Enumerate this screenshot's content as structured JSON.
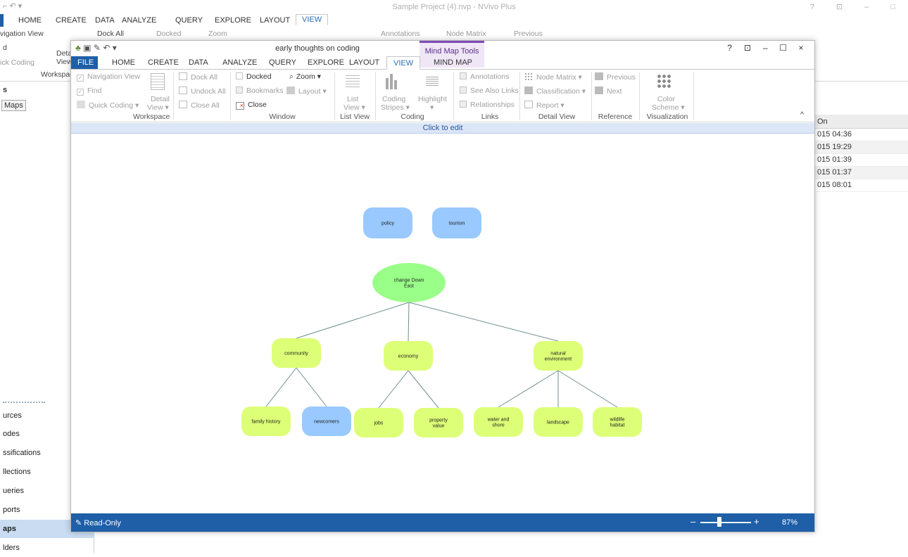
{
  "background_window": {
    "title": "Sample Project (4).nvp - NVivo Plus",
    "tabs": [
      "HOME",
      "CREATE",
      "DATA",
      "ANALYZE",
      "QUERY",
      "EXPLORE",
      "LAYOUT",
      "VIEW"
    ],
    "ribbon": {
      "navigation_view": "vigation View",
      "find": "d",
      "quick_coding": "ick Coding",
      "detail_view": "Deta View",
      "workspace": "Workspac",
      "dock_all": "Dock All",
      "docked": "Docked",
      "zoom": "Zoom",
      "annotations": "Annotations",
      "node_matrix": "Node Matrix",
      "previous": "Previous"
    },
    "left_panel": {
      "heading": "s",
      "maps_button": "Maps",
      "nav_items": [
        "urces",
        "odes",
        "ssifications",
        "llections",
        "ueries",
        "ports",
        "aps",
        "lders"
      ]
    },
    "right_panel": {
      "header": "On",
      "rows": [
        "015 04:36",
        "015 19:29",
        "015 01:39",
        "015 01:37",
        "015 08:01"
      ]
    }
  },
  "popup": {
    "title": "early thoughts on coding",
    "context_tools_label": "Mind Map Tools",
    "tabs": {
      "file": "FILE",
      "home": "HOME",
      "create": "CREATE",
      "data": "DATA",
      "analyze": "ANALYZE",
      "query": "QUERY",
      "explore": "EXPLORE",
      "layout": "LAYOUT",
      "view": "VIEW",
      "mind_map": "MIND MAP"
    },
    "window_controls": {
      "help": "?",
      "restore_ribbon": "⊡",
      "minimize": "–",
      "maximize": "☐",
      "close": "×"
    },
    "ribbon": {
      "workspace": {
        "navigation_view": "Navigation View",
        "find": "Find",
        "quick_coding": "Quick Coding ▾",
        "detail_view_1": "Detail",
        "detail_view_2": "View ▾",
        "group": "Workspace"
      },
      "dock": {
        "dock_all": "Dock All",
        "undock_all": "Undock All",
        "close_all": "Close All"
      },
      "window": {
        "docked": "Docked",
        "bookmarks": "Bookmarks",
        "close": "Close",
        "zoom": "Zoom ▾",
        "layout": "Layout ▾",
        "group": "Window"
      },
      "list_view": {
        "label_1": "List",
        "label_2": "View ▾",
        "group": "List View"
      },
      "coding": {
        "stripes_1": "Coding",
        "stripes_2": "Stripes ▾",
        "highlight": "Highlight",
        "highlight_arrow": "▾",
        "group": "Coding"
      },
      "links": {
        "annotations": "Annotations",
        "see_also": "See Also Links",
        "relationships": "Relationships",
        "group": "Links"
      },
      "detail_view": {
        "node_matrix": "Node Matrix ▾",
        "classification": "Classification ▾",
        "report": "Report ▾",
        "group": "Detail View"
      },
      "reference": {
        "previous": "Previous",
        "next": "Next",
        "group": "Reference"
      },
      "visualization": {
        "color_1": "Color",
        "color_2": "Scheme ▾",
        "group": "Visualization"
      },
      "collapse": "^"
    },
    "click_to_edit": "Click to edit",
    "mind_map": {
      "nodes": {
        "policy": "policy",
        "tourism": "tourism",
        "root_line1": "change Down",
        "root_line2": "East",
        "community": "community",
        "economy": "economy",
        "natural_line1": "natural",
        "natural_line2": "environment",
        "family_history": "family history",
        "newcomers": "newcomers",
        "jobs": "jobs",
        "property_line1": "property",
        "property_line2": "value",
        "water_line1": "water and",
        "water_line2": "shore",
        "landscape": "landscape",
        "wildlife_line1": "wildlife",
        "wildlife_line2": "habitat"
      },
      "colors": {
        "root": "#99ff88",
        "child": "#ddff77",
        "floating": "#99c9ff",
        "line": "#6f8f8f"
      }
    },
    "status": {
      "read_only": "Read-Only",
      "zoom_percent": "87%",
      "minus": "–",
      "plus": "+"
    }
  }
}
